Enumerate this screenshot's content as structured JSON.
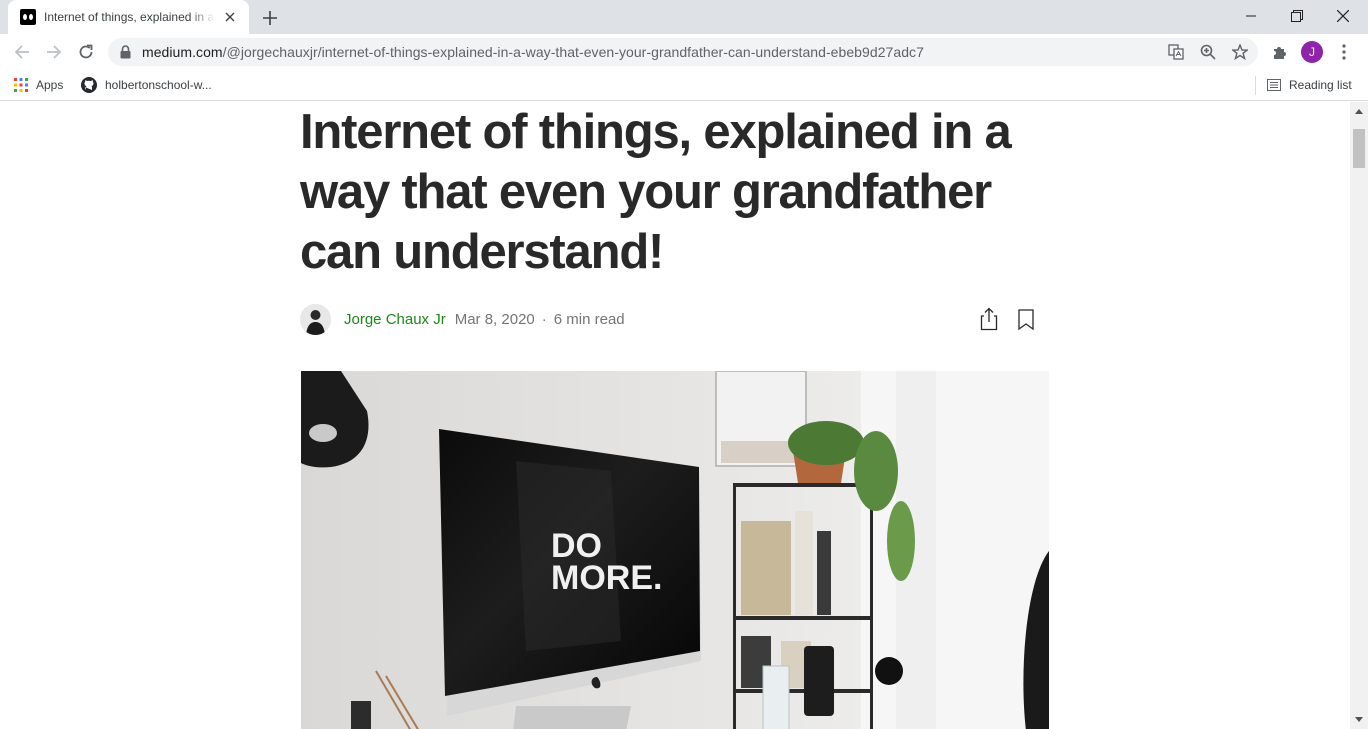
{
  "browser": {
    "tab": {
      "title": "Internet of things, explained in a way that even your grandfather can understand!"
    },
    "address": {
      "host": "medium.com",
      "path": "/@jorgechauxjr/internet-of-things-explained-in-a-way-that-even-your-grandfather-can-understand-ebeb9d27adc7"
    },
    "profile_initial": "J",
    "bookmarks": {
      "apps_label": "Apps",
      "github_label": "holbertonschool-w...",
      "reading_list_label": "Reading list"
    }
  },
  "article": {
    "title": "Internet of things, explained in a way that even your grandfather can understand!",
    "author": "Jorge Chaux Jr",
    "date": "Mar 8, 2020",
    "separator": "·",
    "read_time": "6 min read",
    "hero_screen_text": [
      "DO",
      "MORE."
    ]
  },
  "colors": {
    "author_link": "#1a8917",
    "headline": "#292929",
    "meta": "#757575",
    "profile": "#8e24aa"
  }
}
